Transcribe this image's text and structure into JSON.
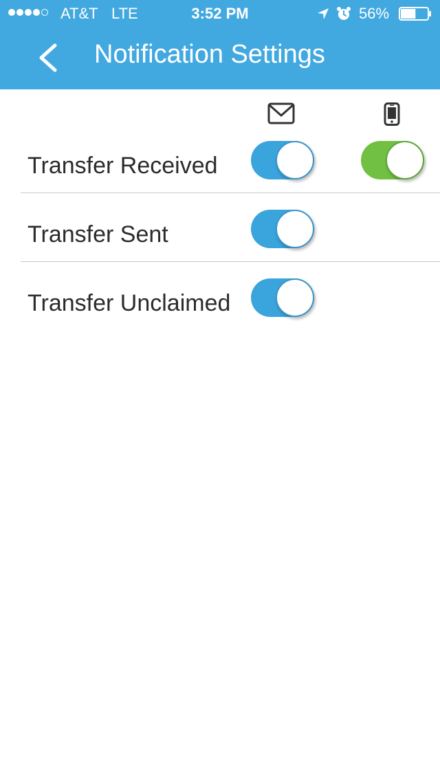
{
  "status_bar": {
    "carrier": "AT&T",
    "network": "LTE",
    "time": "3:52 PM",
    "battery": "56%",
    "battery_level": 0.56,
    "signal_bars_filled": 4,
    "signal_bars_total": 5
  },
  "nav": {
    "title": "Notification Settings",
    "back_icon": "chevron-left-icon"
  },
  "columns": {
    "email_icon": "mail-icon",
    "push_icon": "phone-icon"
  },
  "settings": [
    {
      "label": "Transfer Received",
      "email": true,
      "push": true
    },
    {
      "label": "Transfer Sent",
      "email": true
    },
    {
      "label": "Transfer Unclaimed",
      "email": true
    }
  ],
  "colors": {
    "header": "#42a9e0",
    "toggle_email_on": "#3aa4dc",
    "toggle_push_on": "#71c043",
    "text": "#2b2b2b",
    "divider": "#c8c8c8"
  }
}
